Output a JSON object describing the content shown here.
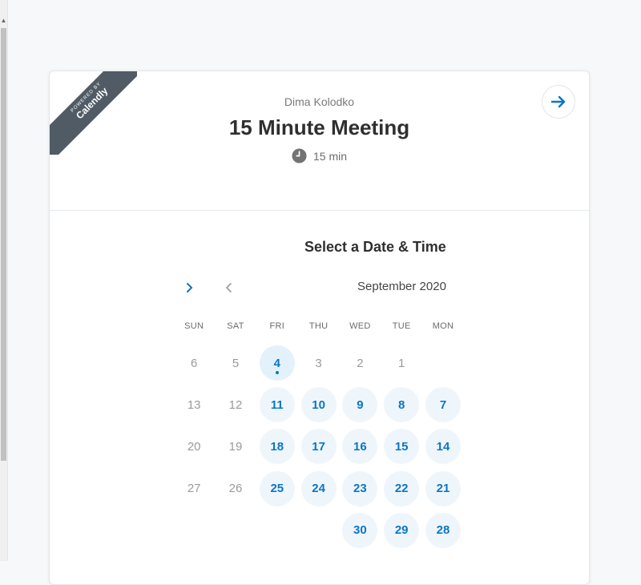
{
  "ribbon": {
    "small": "POWERED BY",
    "brand": "Calendly"
  },
  "event": {
    "organizer": "Dima Kolodko",
    "title": "15 Minute Meeting",
    "duration": "15 min"
  },
  "section_title": "Select a Date & Time",
  "calendar": {
    "month": "September 2020",
    "weekdays": [
      "MON",
      "TUE",
      "WED",
      "THU",
      "FRI",
      "SAT",
      "SUN"
    ],
    "selected_day": "4",
    "weeks": [
      [
        {
          "n": "",
          "s": "empty"
        },
        {
          "n": "1",
          "s": "unavail"
        },
        {
          "n": "2",
          "s": "unavail"
        },
        {
          "n": "3",
          "s": "unavail"
        },
        {
          "n": "4",
          "s": "avail"
        },
        {
          "n": "5",
          "s": "unavail"
        },
        {
          "n": "6",
          "s": "unavail"
        }
      ],
      [
        {
          "n": "7",
          "s": "avail"
        },
        {
          "n": "8",
          "s": "avail"
        },
        {
          "n": "9",
          "s": "avail"
        },
        {
          "n": "10",
          "s": "avail"
        },
        {
          "n": "11",
          "s": "avail"
        },
        {
          "n": "12",
          "s": "unavail"
        },
        {
          "n": "13",
          "s": "unavail"
        }
      ],
      [
        {
          "n": "14",
          "s": "avail"
        },
        {
          "n": "15",
          "s": "avail"
        },
        {
          "n": "16",
          "s": "avail"
        },
        {
          "n": "17",
          "s": "avail"
        },
        {
          "n": "18",
          "s": "avail"
        },
        {
          "n": "19",
          "s": "unavail"
        },
        {
          "n": "20",
          "s": "unavail"
        }
      ],
      [
        {
          "n": "21",
          "s": "avail"
        },
        {
          "n": "22",
          "s": "avail"
        },
        {
          "n": "23",
          "s": "avail"
        },
        {
          "n": "24",
          "s": "avail"
        },
        {
          "n": "25",
          "s": "avail"
        },
        {
          "n": "26",
          "s": "unavail"
        },
        {
          "n": "27",
          "s": "unavail"
        }
      ],
      [
        {
          "n": "28",
          "s": "avail"
        },
        {
          "n": "29",
          "s": "avail"
        },
        {
          "n": "30",
          "s": "avail"
        },
        {
          "n": "",
          "s": "empty"
        },
        {
          "n": "",
          "s": "empty"
        },
        {
          "n": "",
          "s": "empty"
        },
        {
          "n": "",
          "s": "empty"
        }
      ]
    ]
  },
  "icons": {
    "next": "arrow-right-icon",
    "clock": "clock-icon",
    "prev_month": "chevron-left-icon",
    "next_month": "chevron-right-icon"
  },
  "colors": {
    "accent": "#0b76c4",
    "available_bg": "#eef6fc",
    "ribbon_bg": "#505b65"
  }
}
